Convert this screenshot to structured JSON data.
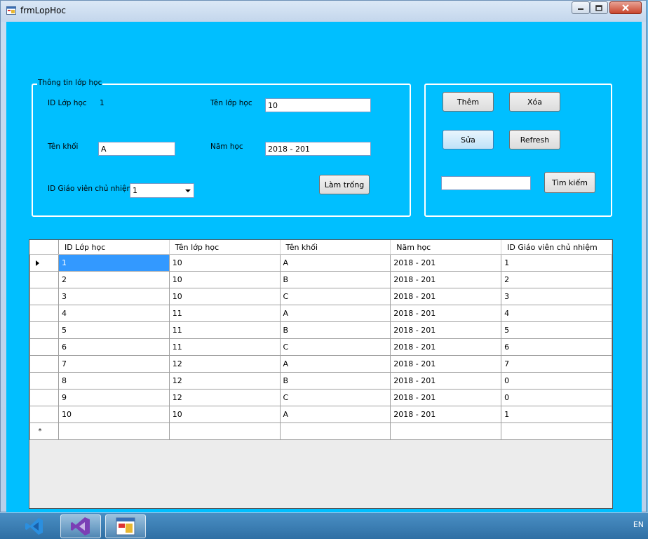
{
  "window": {
    "title": "frmLopHoc"
  },
  "groupbox": {
    "title": "Thông tin lớp học",
    "id_label": "ID Lớp học",
    "id_value": "1",
    "ten_lop_label": "Tên lớp học",
    "ten_lop_value": "10",
    "ten_khoi_label": "Tên khối",
    "ten_khoi_value": "A",
    "nam_hoc_label": "Năm học",
    "nam_hoc_value": "2018 - 201",
    "gvcn_label": "ID Giáo viên chủ nhiệm",
    "gvcn_value": "1",
    "clear_button": "Làm trống"
  },
  "actions": {
    "add": "Thêm",
    "delete": "Xóa",
    "edit": "Sửa",
    "refresh": "Refresh",
    "search_value": "",
    "search": "Tìm kiếm"
  },
  "grid": {
    "columns": [
      "ID Lớp học",
      "Tên lớp học",
      "Tên khối",
      "Năm học",
      "ID Giáo viên chủ nhiệm"
    ],
    "rows": [
      [
        "1",
        "10",
        "A",
        "2018 - 201",
        "1"
      ],
      [
        "2",
        "10",
        "B",
        "2018 - 201",
        "2"
      ],
      [
        "3",
        "10",
        "C",
        "2018 - 201",
        "3"
      ],
      [
        "4",
        "11",
        "A",
        "2018 - 201",
        "4"
      ],
      [
        "5",
        "11",
        "B",
        "2018 - 201",
        "5"
      ],
      [
        "6",
        "11",
        "C",
        "2018 - 201",
        "6"
      ],
      [
        "7",
        "12",
        "A",
        "2018 - 201",
        "7"
      ],
      [
        "8",
        "12",
        "B",
        "2018 - 201",
        "0"
      ],
      [
        "9",
        "12",
        "C",
        "2018 - 201",
        "0"
      ],
      [
        "10",
        "10",
        "A",
        "2018 - 201",
        "1"
      ]
    ],
    "new_row_marker": "*"
  },
  "taskbar": {
    "language": "EN"
  },
  "colors": {
    "form_background": "#00bfff",
    "selection": "#3399ff"
  }
}
